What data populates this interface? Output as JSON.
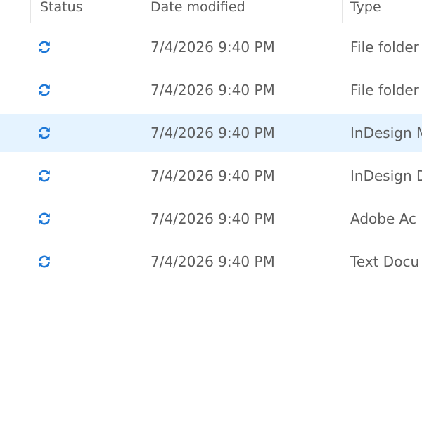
{
  "columns": {
    "status": "Status",
    "date_modified": "Date modified",
    "type": "Type"
  },
  "accent_color": "#1e78d7",
  "selected_row_color": "#e5f3ff",
  "rows": [
    {
      "status_icon": "sync-pending-icon",
      "date": "7/4/2026 9:40 PM",
      "type": "File folder",
      "selected": false
    },
    {
      "status_icon": "sync-pending-icon",
      "date": "7/4/2026 9:40 PM",
      "type": "File folder",
      "selected": false
    },
    {
      "status_icon": "sync-pending-icon",
      "date": "7/4/2026 9:40 PM",
      "type": "InDesign M",
      "selected": true
    },
    {
      "status_icon": "sync-pending-icon",
      "date": "7/4/2026 9:40 PM",
      "type": "InDesign D",
      "selected": false
    },
    {
      "status_icon": "sync-pending-icon",
      "date": "7/4/2026 9:40 PM",
      "type": "Adobe Ac",
      "selected": false
    },
    {
      "status_icon": "sync-pending-icon",
      "date": "7/4/2026 9:40 PM",
      "type": "Text Docu",
      "selected": false
    }
  ]
}
